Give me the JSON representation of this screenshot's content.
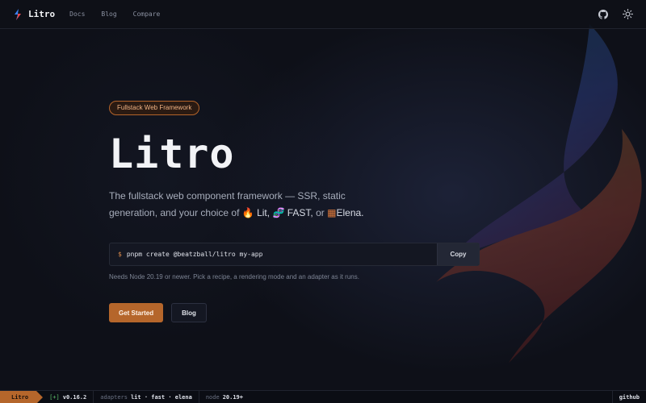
{
  "nav": {
    "brand": "Litro",
    "links": [
      "Docs",
      "Blog",
      "Compare"
    ],
    "github_icon": "github-icon",
    "theme_icon": "sun-icon"
  },
  "hero": {
    "badge": "Fullstack Web Framework",
    "title": "Litro",
    "desc_before": "The fullstack web component framework — SSR, static generation, and your choice of",
    "lit": "Lit,",
    "fast": "FAST,",
    "or": "or",
    "elena": "Elena."
  },
  "command": {
    "prompt": "$",
    "text": "pnpm create @beatzball/litro my-app",
    "copy_label": "Copy",
    "hint": "Needs Node 20.19 or newer. Pick a recipe, a rendering mode and an adapter as it runs."
  },
  "actions": {
    "primary": "Get Started",
    "secondary": "Blog"
  },
  "statusbar": {
    "brand": "Litro",
    "plus": "[+]",
    "version": "v0.16.2",
    "adapters_key": "adapters",
    "adapters_val": "lit · fast · elena",
    "node_key": "node",
    "node_val": "20.19+",
    "right": "github"
  },
  "colors": {
    "accent": "#b5662b",
    "background": "#0e1018"
  }
}
